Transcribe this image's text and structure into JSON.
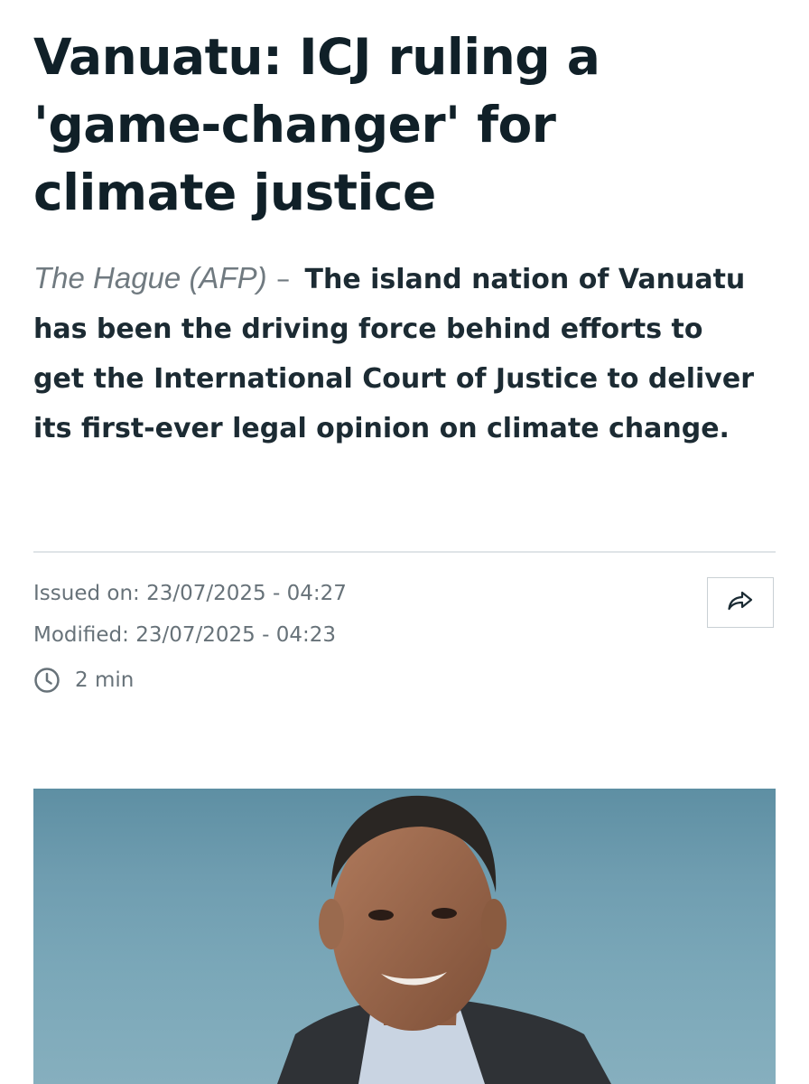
{
  "article": {
    "title": "Vanuatu: ICJ ruling a 'game-changer' for climate justice",
    "dateline": "The Hague (AFP)",
    "separator": "–",
    "lead": "The island nation of Vanuatu has been the driving force behind efforts to get the International Court of Justice to deliver its first-ever legal opinion on climate change."
  },
  "meta": {
    "issued": "Issued on: 23/07/2025 - 04:27",
    "modified": "Modified: 23/07/2025 - 04:23",
    "read_time": "2 min"
  },
  "icons": {
    "share": "share-arrow-icon",
    "clock": "clock-icon"
  },
  "colors": {
    "title": "#102028",
    "meta": "#677279",
    "divider": "#dfe4e7"
  }
}
